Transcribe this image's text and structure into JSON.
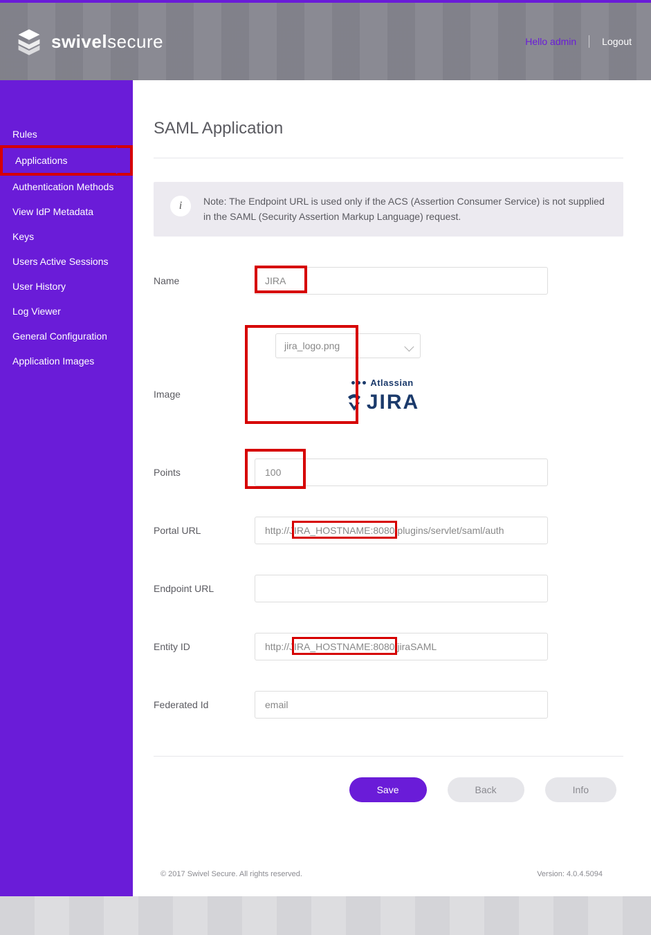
{
  "brand": {
    "name_bold": "swivel",
    "name_light": "secure"
  },
  "header": {
    "greeting": "Hello admin",
    "logout": "Logout"
  },
  "sidebar": {
    "items": [
      {
        "label": "Rules"
      },
      {
        "label": "Applications",
        "active": true
      },
      {
        "label": "Authentication Methods"
      },
      {
        "label": "View IdP Metadata"
      },
      {
        "label": "Keys"
      },
      {
        "label": "Users Active Sessions"
      },
      {
        "label": "User History"
      },
      {
        "label": "Log Viewer"
      },
      {
        "label": "General Configuration"
      },
      {
        "label": "Application Images"
      }
    ]
  },
  "page": {
    "title": "SAML Application",
    "note_icon": "i",
    "note": "Note: The Endpoint URL is used only if the ACS (Assertion Consumer Service) is not supplied in the SAML (Security Assertion Markup Language) request."
  },
  "form": {
    "name": {
      "label": "Name",
      "value": "JIRA"
    },
    "image": {
      "label": "Image",
      "selected": "jira_logo.png",
      "preview_top_dots": 3,
      "preview_top_text": "Atlassian",
      "preview_main": "JIRA"
    },
    "points": {
      "label": "Points",
      "value": "100"
    },
    "portal_url": {
      "label": "Portal URL",
      "value": "http://JIRA_HOSTNAME:8080/plugins/servlet/saml/auth",
      "highlight_text": "JIRA_HOSTNAME:8080"
    },
    "endpoint_url": {
      "label": "Endpoint URL",
      "value": ""
    },
    "entity_id": {
      "label": "Entity ID",
      "value": "http://JIRA_HOSTNAME:8080/jiraSAML",
      "highlight_text": "JIRA_HOSTNAME:8080"
    },
    "federated_id": {
      "label": "Federated Id",
      "value": "email"
    }
  },
  "actions": {
    "save": "Save",
    "back": "Back",
    "info": "Info"
  },
  "footer": {
    "copyright": "© 2017 Swivel Secure. All rights reserved.",
    "version": "Version: 4.0.4.5094"
  },
  "colors": {
    "accent": "#6a1cd8",
    "highlight": "#d60000"
  }
}
